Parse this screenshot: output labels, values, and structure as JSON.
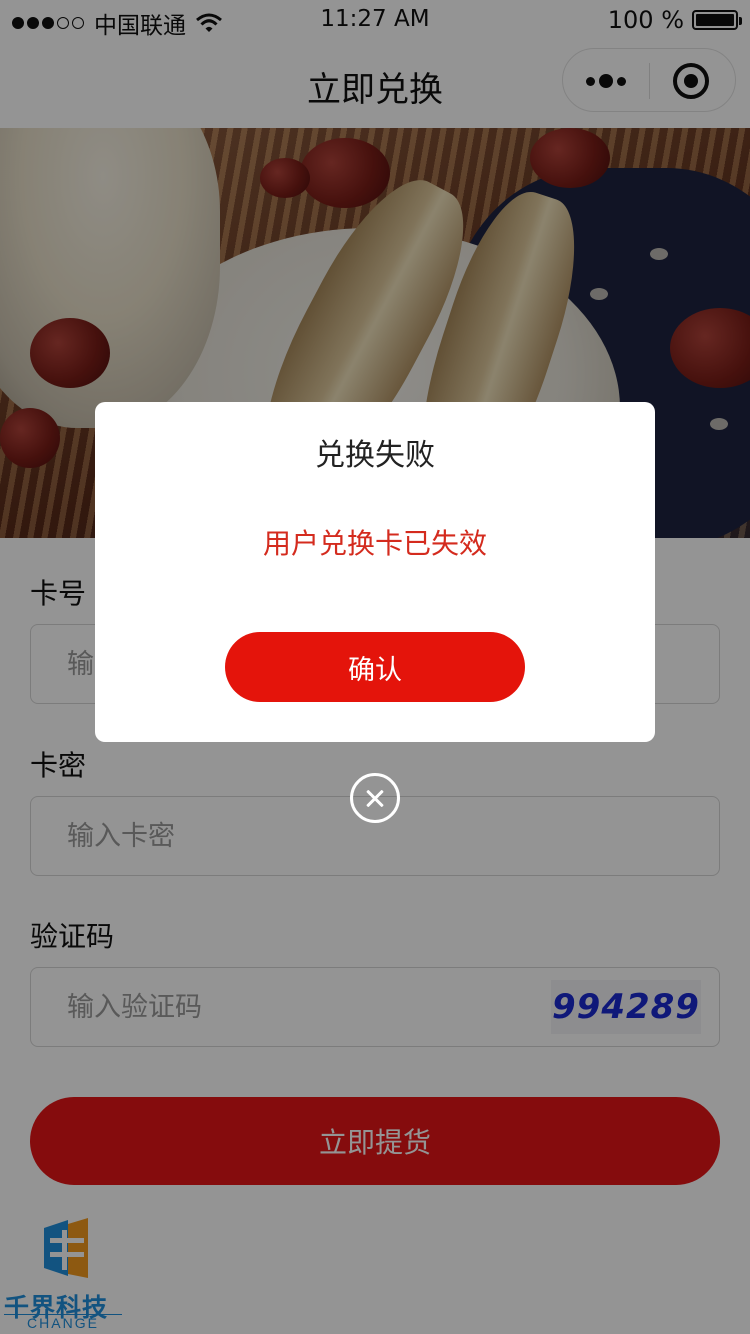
{
  "status_bar": {
    "carrier": "中国联通",
    "time": "11:27 AM",
    "battery": "100 %",
    "signal_bars": 3,
    "signal_total": 5
  },
  "nav": {
    "title": "立即兑换",
    "more_icon": "more-dots-icon",
    "close_icon": "target-close-icon"
  },
  "form": {
    "card_number": {
      "label": "卡号",
      "placeholder": "输入卡号"
    },
    "card_password": {
      "label": "卡密",
      "placeholder": "输入卡密"
    },
    "captcha": {
      "label": "验证码",
      "placeholder": "输入验证码",
      "code": "994289"
    },
    "submit_label": "立即提货"
  },
  "dialog": {
    "title": "兑换失败",
    "message": "用户兑换卡已失效",
    "confirm_label": "确认"
  },
  "watermark": {
    "brand": "千界科技",
    "subtitle": "CHANGE"
  },
  "colors": {
    "accent_red": "#e51617",
    "error_text": "#d42b1e",
    "brand_blue": "#1f8fdc"
  }
}
